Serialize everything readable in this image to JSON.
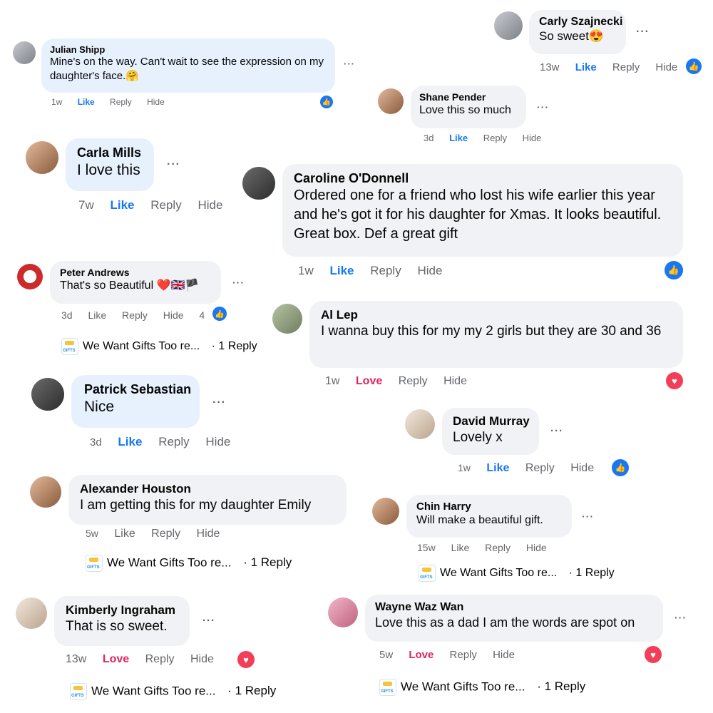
{
  "actions": {
    "like": "Like",
    "love": "Love",
    "reply": "Reply",
    "hide": "Hide",
    "more": "···"
  },
  "reply_summary": {
    "page": "We Want Gifts Too re...",
    "count": "· 1 Reply"
  },
  "comments": {
    "carly": {
      "name": "Carly Szajnecki",
      "text": "So sweet😍",
      "time": "13w"
    },
    "julian": {
      "name": "Julian Shipp",
      "text": "Mine's on the way. Can't wait to see the expression on my daughter's face.🤗",
      "time": "1w"
    },
    "shane": {
      "name": "Shane Pender",
      "text": "Love this so much",
      "time": "3d"
    },
    "carla": {
      "name": "Carla Mills",
      "text": "I love this",
      "time": "7w"
    },
    "caroline": {
      "name": "Caroline O'Donnell",
      "text": "Ordered one for a friend who lost his wife earlier this year and he's got it for his daughter for Xmas. It looks beautiful. Great box. Def a great gift",
      "time": "1w"
    },
    "peter": {
      "name": "Peter Andrews",
      "text": "That's so Beautiful ❤️🇬🇧🏴",
      "time": "3d",
      "react_count": "4"
    },
    "al": {
      "name": "Al Lep",
      "text": "I wanna buy this for my my 2 girls but they are 30 and 36",
      "time": "1w"
    },
    "patrick": {
      "name": "Patrick Sebastian",
      "text": "Nice",
      "time": "3d"
    },
    "david": {
      "name": "David Murray",
      "text": "Lovely x",
      "time": "1w"
    },
    "alexander": {
      "name": "Alexander Houston",
      "text": "I am getting this for my daughter Emily",
      "time": "5w"
    },
    "chin": {
      "name": "Chin Harry",
      "text": "Will make a beautiful gift.",
      "time": "15w"
    },
    "kimberly": {
      "name": "Kimberly Ingraham",
      "text": "That is so sweet.",
      "time": "13w"
    },
    "wayne": {
      "name": "Wayne Waz Wan",
      "text": "Love this as a dad I am the words are spot on",
      "time": "5w"
    }
  },
  "colors": {
    "like": "#1877f2",
    "love": "#e0245e",
    "bubble": "#f0f2f5",
    "muted": "#65676b"
  }
}
